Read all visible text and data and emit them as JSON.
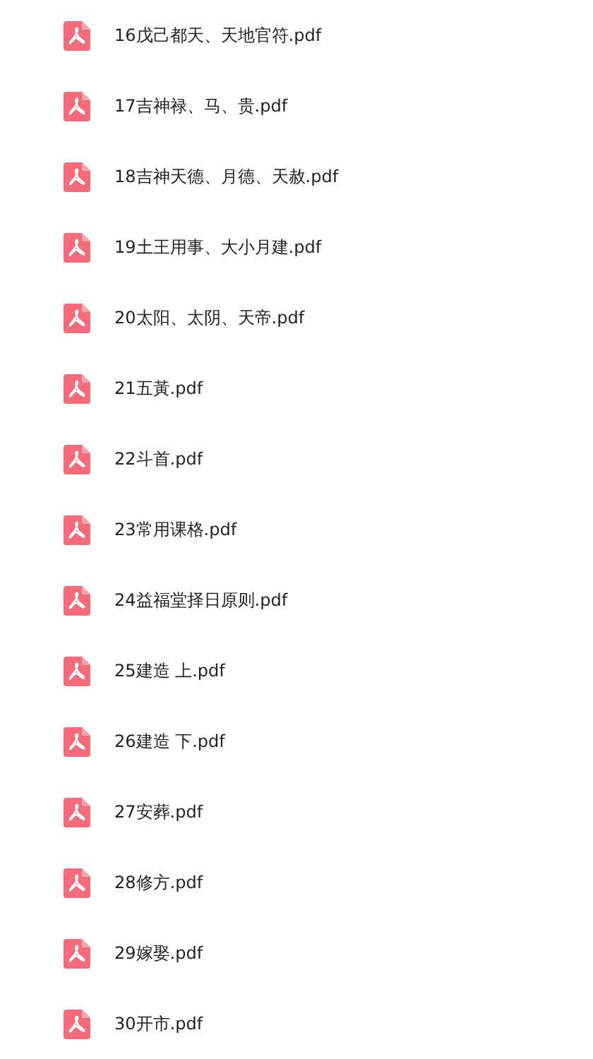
{
  "files": [
    {
      "name": "16戊己都天、天地官符.pdf"
    },
    {
      "name": "17吉神禄、马、贵.pdf"
    },
    {
      "name": "18吉神天德、月德、天赦.pdf"
    },
    {
      "name": "19土王用事、大小月建.pdf"
    },
    {
      "name": "20太阳、太阴、天帝.pdf"
    },
    {
      "name": "21五黃.pdf"
    },
    {
      "name": "22斗首.pdf"
    },
    {
      "name": "23常用课格.pdf"
    },
    {
      "name": "24益福堂择日原则.pdf"
    },
    {
      "name": "25建造 上.pdf"
    },
    {
      "name": "26建造 下.pdf"
    },
    {
      "name": "27安葬.pdf"
    },
    {
      "name": "28修方.pdf"
    },
    {
      "name": "29嫁娶.pdf"
    },
    {
      "name": "30开市.pdf"
    }
  ]
}
